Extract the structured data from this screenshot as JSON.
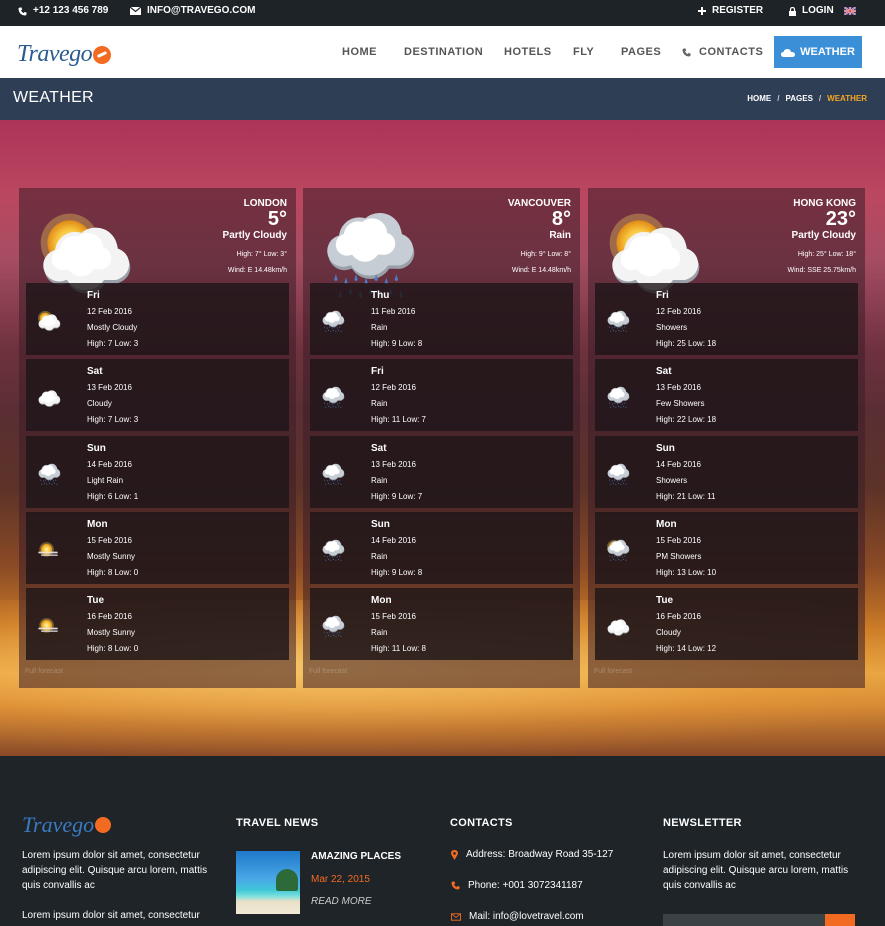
{
  "topbar": {
    "phone": "+12 123 456 789",
    "email": "INFO@TRAVEGO.COM",
    "register": "REGISTER",
    "login": "LOGIN"
  },
  "brand": {
    "name": "Travego"
  },
  "nav": {
    "home": "HOME",
    "destination": "DESTINATION",
    "hotels": "HOTELS",
    "fly": "FLY",
    "pages": "PAGES",
    "contacts": "CONTACTS",
    "weather": "WEATHER"
  },
  "page": {
    "title": "WEATHER",
    "breadcrumb": [
      "HOME",
      "PAGES",
      "WEATHER"
    ]
  },
  "cities": [
    {
      "name": "LONDON",
      "temp": "5°",
      "condition": "Partly Cloudy",
      "high_low": "High: 7° Low: 3°",
      "wind": "Wind: E 14.48km/h",
      "icon": "sun-cloud-icon",
      "foot": "Full forecast",
      "days": [
        {
          "day": "Fri",
          "date": "12 Feb 2016",
          "cond": "Mostly Cloudy",
          "hl": "High: 7 Low: 3",
          "icon": "sun-cloud-icon"
        },
        {
          "day": "Sat",
          "date": "13 Feb 2016",
          "cond": "Cloudy",
          "hl": "High: 7 Low: 3",
          "icon": "cloud-icon"
        },
        {
          "day": "Sun",
          "date": "14 Feb 2016",
          "cond": "Light Rain",
          "hl": "High: 6 Low: 1",
          "icon": "rain-icon"
        },
        {
          "day": "Mon",
          "date": "15 Feb 2016",
          "cond": "Mostly Sunny",
          "hl": "High: 8 Low: 0",
          "icon": "sun-haze-icon"
        },
        {
          "day": "Tue",
          "date": "16 Feb 2016",
          "cond": "Mostly Sunny",
          "hl": "High: 8 Low: 0",
          "icon": "sun-haze-icon"
        }
      ]
    },
    {
      "name": "VANCOUVER",
      "temp": "8°",
      "condition": "Rain",
      "high_low": "High: 9° Low: 8°",
      "wind": "Wind: E 14.48km/h",
      "icon": "rain-icon",
      "foot": "Full forecast",
      "days": [
        {
          "day": "Thu",
          "date": "11 Feb 2016",
          "cond": "Rain",
          "hl": "High: 9 Low: 8",
          "icon": "rain-icon"
        },
        {
          "day": "Fri",
          "date": "12 Feb 2016",
          "cond": "Rain",
          "hl": "High: 11 Low: 7",
          "icon": "rain-icon"
        },
        {
          "day": "Sat",
          "date": "13 Feb 2016",
          "cond": "Rain",
          "hl": "High: 9 Low: 7",
          "icon": "rain-icon"
        },
        {
          "day": "Sun",
          "date": "14 Feb 2016",
          "cond": "Rain",
          "hl": "High: 9 Low: 8",
          "icon": "rain-icon"
        },
        {
          "day": "Mon",
          "date": "15 Feb 2016",
          "cond": "Rain",
          "hl": "High: 11 Low: 8",
          "icon": "rain-icon"
        }
      ]
    },
    {
      "name": "HONG KONG",
      "temp": "23°",
      "condition": "Partly Cloudy",
      "high_low": "High: 25° Low: 18°",
      "wind": "Wind: SSE 25.75km/h",
      "icon": "sun-cloud-icon",
      "foot": "Full forecast",
      "days": [
        {
          "day": "Fri",
          "date": "12 Feb 2016",
          "cond": "Showers",
          "hl": "High: 25 Low: 18",
          "icon": "rain-icon"
        },
        {
          "day": "Sat",
          "date": "13 Feb 2016",
          "cond": "Few Showers",
          "hl": "High: 22 Low: 18",
          "icon": "rain-icon"
        },
        {
          "day": "Sun",
          "date": "14 Feb 2016",
          "cond": "Showers",
          "hl": "High: 21 Low: 11",
          "icon": "rain-icon"
        },
        {
          "day": "Mon",
          "date": "15 Feb 2016",
          "cond": "PM Showers",
          "hl": "High: 13 Low: 10",
          "icon": "sun-rain-icon"
        },
        {
          "day": "Tue",
          "date": "16 Feb 2016",
          "cond": "Cloudy",
          "hl": "High: 14 Low: 12",
          "icon": "cloud-icon"
        }
      ]
    }
  ],
  "footer": {
    "about": "Lorem ipsum dolor sit amet, consectetur adipiscing elit. Quisque arcu lorem, mattis quis convallis ac",
    "about2": "Lorem ipsum dolor sit amet, consectetur",
    "news_heading": "TRAVEL NEWS",
    "news_title": "AMAZING PLACES",
    "news_date": "Mar 22, 2015",
    "news_more": "READ MORE",
    "contacts_heading": "CONTACTS",
    "address": "Address: Broadway Road 35-127",
    "phone": "Phone: +001 3072341187",
    "mail": "Mail: info@lovetravel.com",
    "newsletter_heading": "NEWSLETTER",
    "newsletter_text": "Lorem ipsum dolor sit amet, consectetur adipiscing elit. Quisque arcu lorem, mattis quis convallis ac"
  },
  "colors": {
    "accent_blue": "#3a8fd6",
    "accent_orange": "#f26b21",
    "breadcrumb_active": "#f5a623",
    "titlebar": "#2e3e55"
  }
}
